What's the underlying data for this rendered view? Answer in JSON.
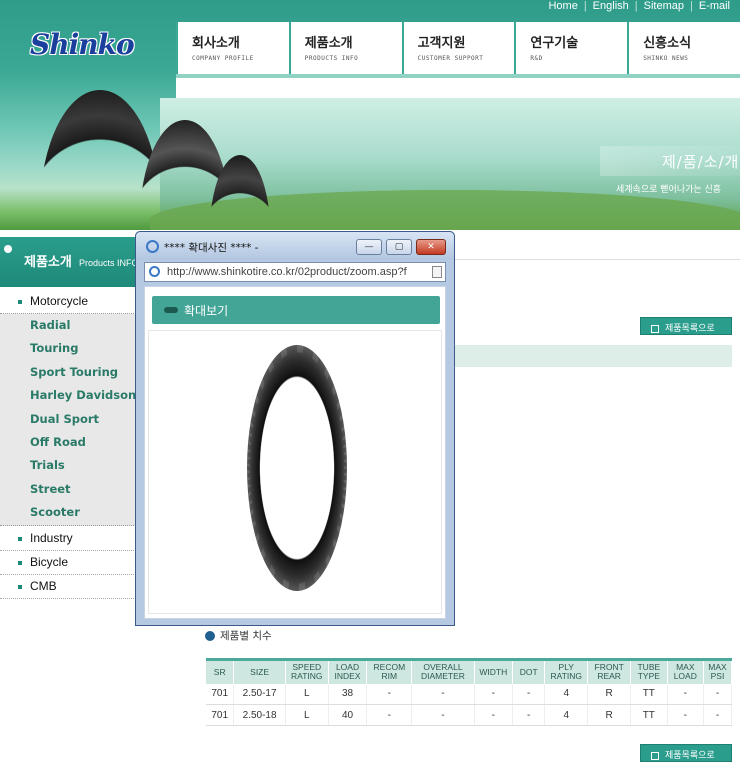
{
  "header": {
    "logo_text": "Shinko",
    "top_links": [
      "Home",
      "English",
      "Sitemap",
      "E-mail"
    ],
    "gnb": [
      {
        "ko": "회사소개",
        "en": "COMPANY PROFILE"
      },
      {
        "ko": "제품소개",
        "en": "PRODUCTS INFO"
      },
      {
        "ko": "고객지원",
        "en": "CUSTOMER SUPPORT"
      },
      {
        "ko": "연구기술",
        "en": "R&D"
      },
      {
        "ko": "신흥소식",
        "en": "SHINKO NEWS"
      }
    ],
    "page_title": "제/품/소/개",
    "page_subtitle": "세계속으로 뻗어나가는 신흥"
  },
  "sidebar": {
    "title_ko": "제품소개",
    "title_en": "Products INFO",
    "current": "Motorcycle",
    "sub_items": [
      "Radial",
      "Touring",
      "Sport Touring",
      "Harley Davidson",
      "Dual Sport",
      "Off Road",
      "Trials",
      "Street",
      "Scooter"
    ],
    "other_items": [
      "Industry",
      "Bicycle",
      "CMB"
    ]
  },
  "content": {
    "list_button_label": "제품목록으로",
    "spec_title": "제품별 치수",
    "table": {
      "headers": [
        [
          "SR"
        ],
        [
          "SIZE"
        ],
        [
          "SPEED",
          "RATING"
        ],
        [
          "LOAD",
          "INDEX"
        ],
        [
          "RECOM",
          "RIM"
        ],
        [
          "OVERALL",
          "DIAMETER"
        ],
        [
          "WIDTH"
        ],
        [
          "DOT"
        ],
        [
          "PLY",
          "RATING"
        ],
        [
          "FRONT",
          "REAR"
        ],
        [
          "TUBE",
          "TYPE"
        ],
        [
          "MAX",
          "LOAD"
        ],
        [
          "MAX",
          "PSI"
        ]
      ],
      "rows": [
        [
          "701",
          "2.50-17",
          "L",
          "38",
          "-",
          "-",
          "-",
          "-",
          "4",
          "R",
          "TT",
          "-",
          "-"
        ],
        [
          "701",
          "2.50-18",
          "L",
          "40",
          "-",
          "-",
          "-",
          "-",
          "4",
          "R",
          "TT",
          "-",
          "-"
        ]
      ]
    }
  },
  "popup": {
    "window_title": "**** 확대사진 **** -",
    "minimize": "—",
    "maximize": "▢",
    "close": "✕",
    "address": "http://www.shinkotire.co.kr/02product/zoom.asp?f",
    "zoom_heading": "확대보기"
  }
}
